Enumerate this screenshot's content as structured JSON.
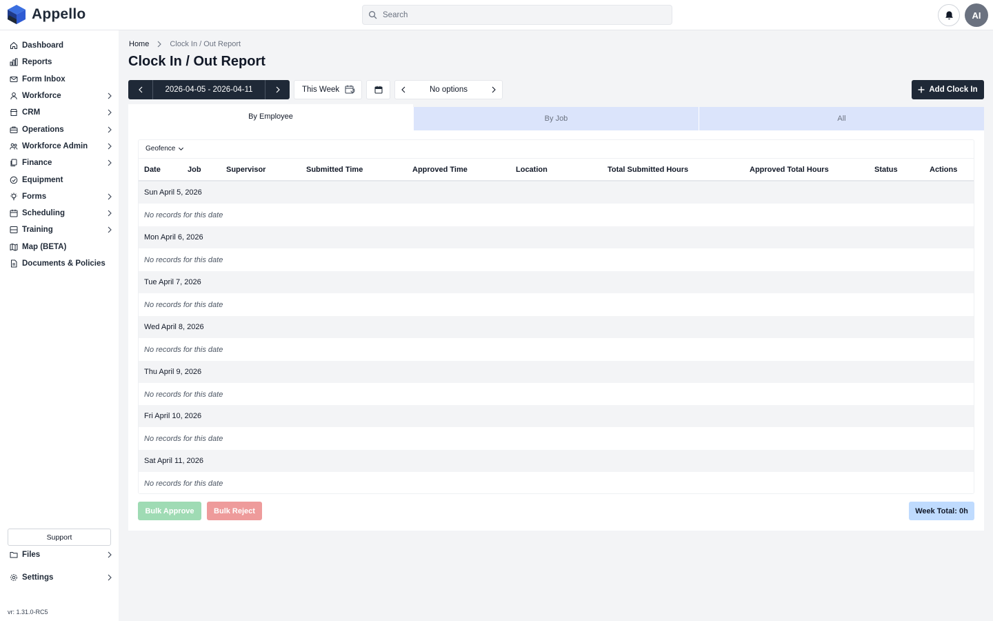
{
  "app": {
    "name": "Appello",
    "brand_color": "#2f5bd3"
  },
  "header": {
    "search_placeholder": "Search",
    "avatar_initials": "AI"
  },
  "sidebar": {
    "items": [
      {
        "label": "Dashboard",
        "icon": "home-icon",
        "chevron": false
      },
      {
        "label": "Reports",
        "icon": "bar-chart-icon",
        "chevron": false
      },
      {
        "label": "Form Inbox",
        "icon": "mail-icon",
        "chevron": false
      },
      {
        "label": "Workforce",
        "icon": "user-icon",
        "chevron": true
      },
      {
        "label": "CRM",
        "icon": "store-icon",
        "chevron": true
      },
      {
        "label": "Operations",
        "icon": "briefcase-icon",
        "chevron": true
      },
      {
        "label": "Workforce Admin",
        "icon": "users-icon",
        "chevron": true
      },
      {
        "label": "Finance",
        "icon": "copy-icon",
        "chevron": true
      },
      {
        "label": "Equipment",
        "icon": "gauge-icon",
        "chevron": false
      },
      {
        "label": "Forms",
        "icon": "bulb-icon",
        "chevron": true
      },
      {
        "label": "Scheduling",
        "icon": "calendar-icon",
        "chevron": true
      },
      {
        "label": "Training",
        "icon": "layers-icon",
        "chevron": true
      },
      {
        "label": "Map (BETA)",
        "icon": "map-icon",
        "chevron": false
      },
      {
        "label": "Documents & Policies",
        "icon": "document-icon",
        "chevron": false
      }
    ],
    "support_label": "Support",
    "files_label": "Files",
    "settings_label": "Settings",
    "version": "vr: 1.31.0-RC5"
  },
  "breadcrumb": {
    "home": "Home",
    "current": "Clock In / Out Report"
  },
  "page_title": "Clock In / Out Report",
  "toolbar": {
    "date_range": "2026-04-05 - 2026-04-11",
    "this_week_label": "This Week",
    "options_label": "No options",
    "add_clock_in_label": "Add Clock In"
  },
  "tabs": [
    {
      "label": "By Employee",
      "active": true
    },
    {
      "label": "By Job",
      "active": false
    },
    {
      "label": "All",
      "active": false
    }
  ],
  "table": {
    "filter_label": "Geofence",
    "columns": [
      "Date",
      "Job",
      "Supervisor",
      "Submitted Time",
      "Approved Time",
      "Location",
      "Total Submitted Hours",
      "Approved Total Hours",
      "Status",
      "Actions"
    ],
    "days": [
      {
        "date": "Sun April 5, 2026",
        "empty_text": "No records for this date"
      },
      {
        "date": "Mon April 6, 2026",
        "empty_text": "No records for this date"
      },
      {
        "date": "Tue April 7, 2026",
        "empty_text": "No records for this date"
      },
      {
        "date": "Wed April 8, 2026",
        "empty_text": "No records for this date"
      },
      {
        "date": "Thu April 9, 2026",
        "empty_text": "No records for this date"
      },
      {
        "date": "Fri April 10, 2026",
        "empty_text": "No records for this date"
      },
      {
        "date": "Sat April 11, 2026",
        "empty_text": "No records for this date"
      }
    ]
  },
  "footer": {
    "bulk_approve_label": "Bulk Approve",
    "bulk_reject_label": "Bulk Reject",
    "week_total": "Week Total: 0h"
  }
}
